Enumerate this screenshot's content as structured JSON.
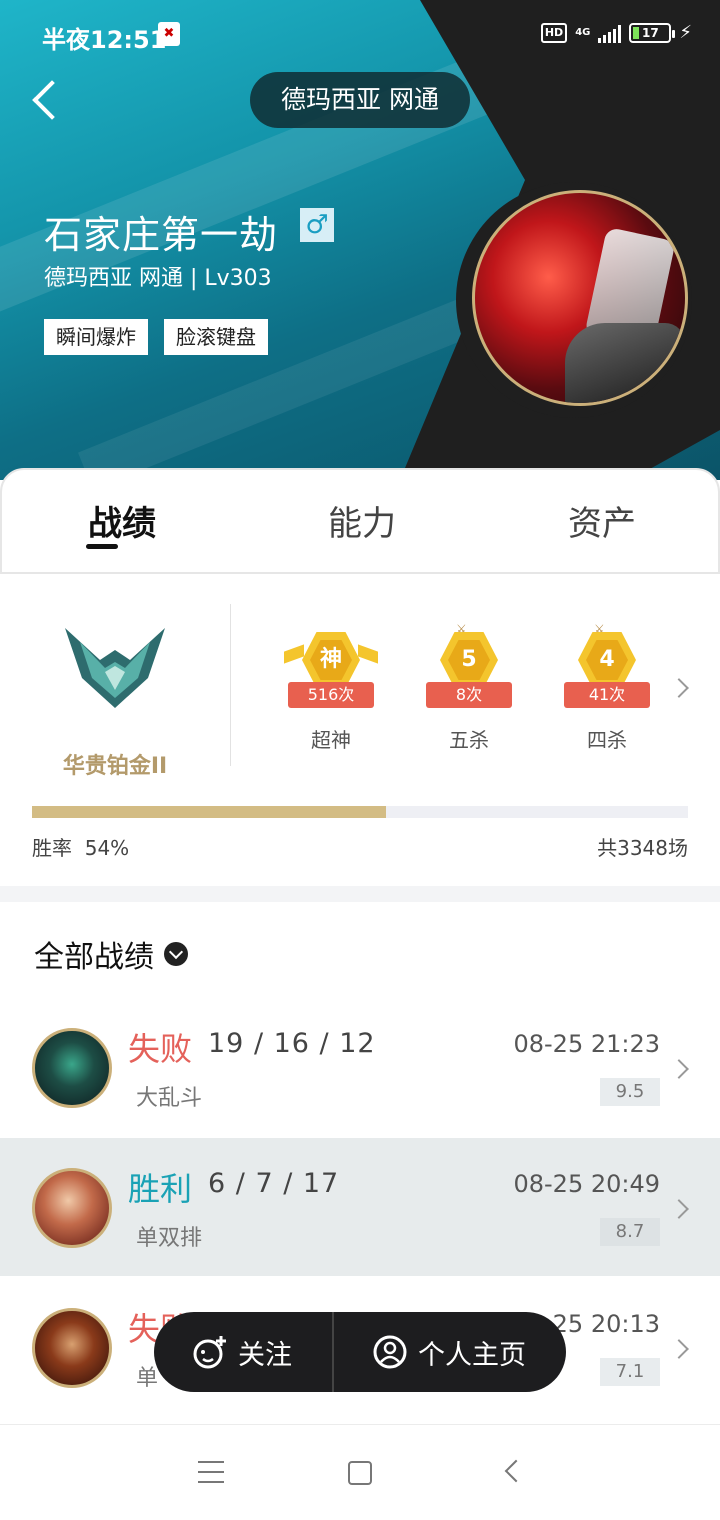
{
  "status_bar": {
    "time": "半夜12:51",
    "hd": "HD",
    "network": "4G",
    "battery": "17"
  },
  "header": {
    "server_pill": "德玛西亚 网通",
    "player_name": "石家庄第一劫",
    "gender": "♂",
    "subtitle": "德玛西亚 网通 | Lv303",
    "tags": [
      "瞬间爆炸",
      "脸滚键盘"
    ]
  },
  "tabs": [
    {
      "label": "战绩",
      "active": true
    },
    {
      "label": "能力",
      "active": false
    },
    {
      "label": "资产",
      "active": false
    }
  ],
  "rank": {
    "name": "华贵铂金II"
  },
  "achievements": [
    {
      "medal": "神",
      "count": "516次",
      "label": "超神"
    },
    {
      "medal": "5",
      "count": "8次",
      "label": "五杀"
    },
    {
      "medal": "4",
      "count": "41次",
      "label": "四杀"
    }
  ],
  "stats": {
    "winrate_label": "胜率",
    "winrate": "54%",
    "winrate_fraction": 0.54,
    "total": "共3348场"
  },
  "filter": {
    "label": "全部战绩"
  },
  "matches": [
    {
      "result": "失败",
      "outcome": "lose",
      "kda": "19 / 16 / 12",
      "mode": "大乱斗",
      "time": "08-25 21:23",
      "score": "9.5"
    },
    {
      "result": "胜利",
      "outcome": "win",
      "kda": "6 / 7 / 17",
      "mode": "单双排",
      "time": "08-25 20:49",
      "score": "8.7"
    },
    {
      "result": "失败",
      "outcome": "lose",
      "kda": "",
      "mode": "单",
      "time": "-25 20:13",
      "score": "7.1"
    }
  ],
  "actions": {
    "follow": "关注",
    "homepage": "个人主页"
  }
}
